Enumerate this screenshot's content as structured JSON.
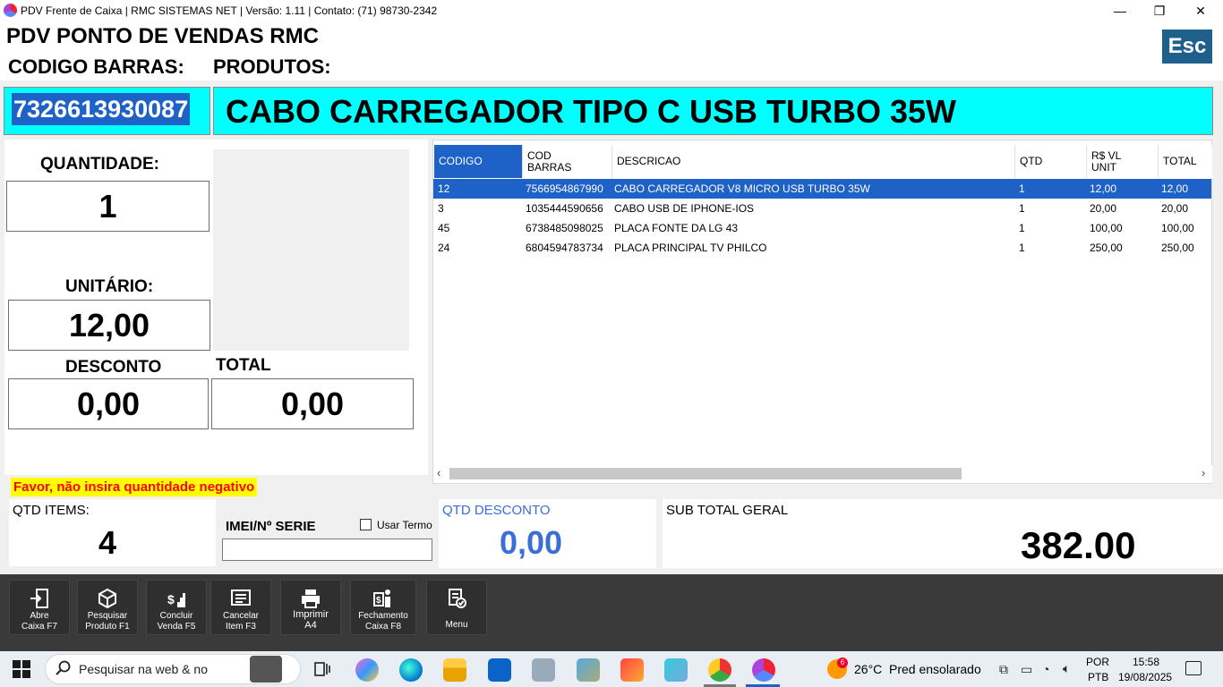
{
  "window": {
    "title": "PDV Frente de Caixa  |  RMC SISTEMAS NET  |  Versão: 1.11  |  Contato: (71) 98730-2342",
    "minimize": "—",
    "maximize": "❐",
    "close": "✕"
  },
  "header": {
    "app_title": "PDV PONTO DE VENDAS RMC",
    "barcode_label": "CODIGO BARRAS:",
    "products_label": "PRODUTOS:",
    "esc_label": "Esc"
  },
  "current": {
    "barcode": "7326613930087",
    "product_name": "CABO CARREGADOR TIPO C USB TURBO 35W"
  },
  "left": {
    "quantity_label": "QUANTIDADE:",
    "quantity_value": "1",
    "unit_label": "UNITÁRIO:",
    "unit_value": "12,00",
    "discount_label": "DESCONTO",
    "discount_value": "0,00",
    "total_label": "TOTAL",
    "total_value": "0,00"
  },
  "grid": {
    "headers": [
      "CODIGO",
      "COD\nBARRAS",
      "DESCRICAO",
      "QTD",
      "R$ VL\nUNIT",
      "TOTAL"
    ],
    "rows": [
      [
        "12",
        "7566954867990",
        "CABO CARREGADOR V8 MICRO USB TURBO 35W",
        "1",
        "12,00",
        "12,00"
      ],
      [
        "3",
        "1035444590656",
        "CABO USB DE IPHONE-IOS",
        "1",
        "20,00",
        "20,00"
      ],
      [
        "45",
        "6738485098025",
        "PLACA FONTE DA LG 43",
        "1",
        "100,00",
        "100,00"
      ],
      [
        "24",
        "6804594783734",
        "PLACA PRINCIPAL TV PHILCO",
        "1",
        "250,00",
        "250,00"
      ]
    ]
  },
  "warning": "Favor, não insira quantidade negativo",
  "summary": {
    "qty_items_label": "QTD ITEMS:",
    "qty_items_value": "4",
    "imei_label": "IMEI/Nº SERIE",
    "imei_value": "",
    "use_term_label": "Usar Termo",
    "qty_discount_label": "QTD DESCONTO",
    "qty_discount_value": "0,00",
    "subtotal_label": "SUB TOTAL GERAL",
    "subtotal_value": "382.00"
  },
  "toolbar": [
    {
      "label": "Abre\nCaixa F7",
      "icon": "door-enter-icon"
    },
    {
      "label": "Pesquisar\nProduto F1",
      "icon": "box-icon"
    },
    {
      "label": "Concluir\nVenda F5",
      "icon": "money-stairs-icon"
    },
    {
      "label": "Cancelar\nItem F3",
      "icon": "cancel-list-icon"
    },
    {
      "label": "Imprimir\nA4",
      "icon": "printer-icon"
    },
    {
      "label": "Fechamento\nCaixa F8",
      "icon": "cash-person-icon"
    },
    {
      "label": "Menu",
      "icon": "menu-doc-icon"
    }
  ],
  "taskbar": {
    "search_placeholder": "Pesquisar na web & no",
    "temperature": "26°C",
    "weather": "Pred ensolarado",
    "weather_badge": "6",
    "lang1": "POR",
    "lang2": "PTB",
    "time": "15:58",
    "date": "19/08/2025"
  },
  "colors": {
    "cyan": "#00ffff",
    "selection_blue": "#1e62c8",
    "warning_red": "#ff0000",
    "warning_yellow": "#ffff00",
    "discount_blue": "#3a6fd8",
    "esc_blue": "#1f5f8b"
  }
}
